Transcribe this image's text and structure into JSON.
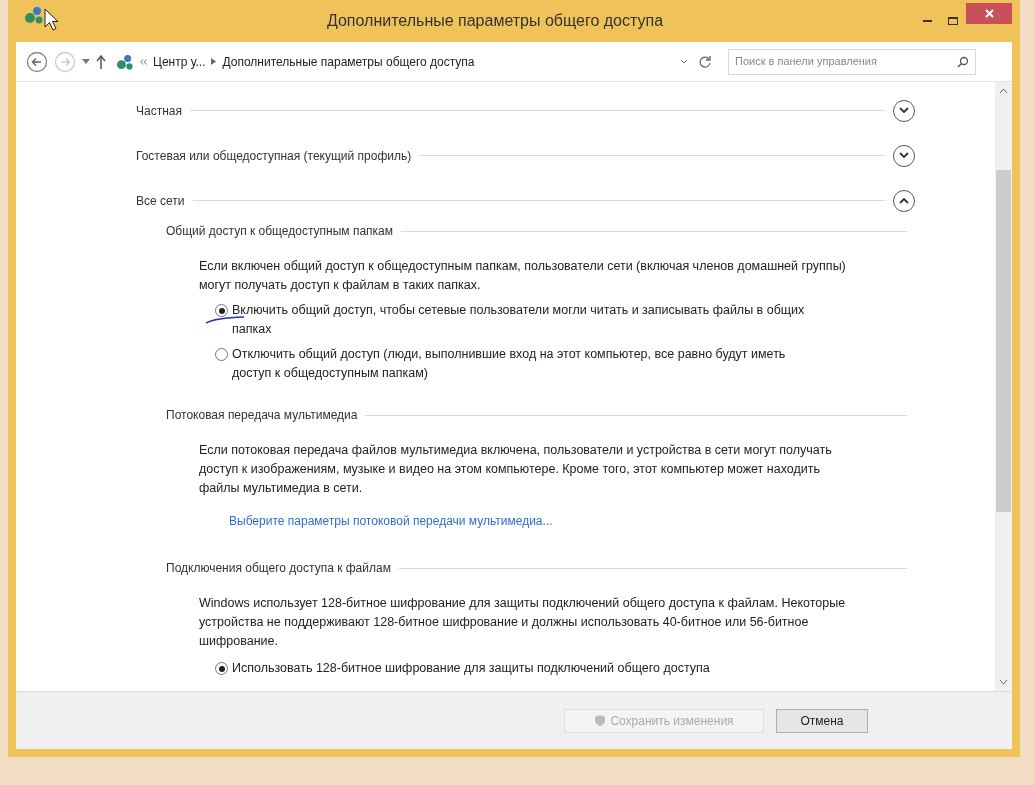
{
  "window": {
    "title": "Дополнительные параметры общего доступа"
  },
  "address_bar": {
    "breadcrumb": [
      "Центр у...",
      "Дополнительные параметры общего доступа"
    ],
    "search_placeholder": "Поиск в панели управления"
  },
  "sections": [
    {
      "title": "Частная",
      "expanded": false
    },
    {
      "title": "Гостевая или общедоступная (текущий профиль)",
      "expanded": false
    },
    {
      "title": "Все сети",
      "expanded": true,
      "groups": [
        {
          "title": "Общий доступ к общедоступным папкам",
          "items": [
            {
              "kind": "text",
              "text": "Если включен общий доступ к общедоступным папкам, пользователи сети (включая членов домашней группы) могут получать доступ к файлам в таких папках."
            },
            {
              "kind": "radio",
              "text": "Включить общий доступ, чтобы сетевые пользователи могли читать и записывать файлы в общих папках",
              "selected": true
            },
            {
              "kind": "radio",
              "text": "Отключить общий доступ (люди, выполнившие вход на этот компьютер, все равно будут иметь доступ к общедоступным папкам)",
              "selected": false
            }
          ]
        },
        {
          "title": "Потоковая передача мультимедиа",
          "items": [
            {
              "kind": "text",
              "text": "Если потоковая передача файлов мультимедиа включена, пользователи и устройства в сети могут получать доступ к изображениям, музыке и видео на этом компьютере. Кроме того, этот компьютер может находить файлы мультимедиа в сети."
            },
            {
              "kind": "link",
              "text": "Выберите параметры потоковой передачи мультимедиа..."
            }
          ]
        },
        {
          "title": "Подключения общего доступа к файлам",
          "items": [
            {
              "kind": "text",
              "text": "Windows использует 128-битное шифрование для защиты подключений общего доступа к файлам. Некоторые устройства не поддерживают 128-битное шифрование и должны использовать 40-битное или 56-битное шифрование."
            },
            {
              "kind": "radio",
              "text": "Использовать 128-битное шифрование для защиты подключений общего доступа",
              "selected": true
            }
          ]
        }
      ]
    }
  ],
  "buttons": [
    {
      "label": "Сохранить изменения",
      "disabled": true
    },
    {
      "label": "Отмена",
      "disabled": false
    }
  ]
}
